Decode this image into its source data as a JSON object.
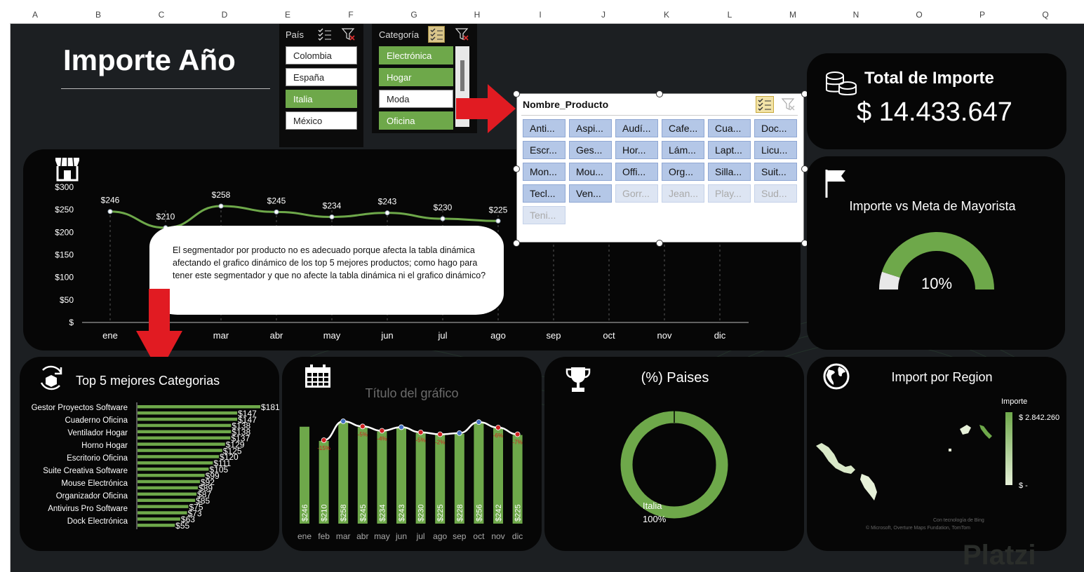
{
  "sheet": {
    "columns": [
      "A",
      "B",
      "C",
      "D",
      "E",
      "F",
      "G",
      "H",
      "I",
      "J",
      "K",
      "L",
      "M",
      "N",
      "O",
      "P",
      "Q"
    ]
  },
  "dashboard": {
    "title": "Importe Año",
    "accent": "#6ea84a"
  },
  "slicer_pais": {
    "header": "País",
    "items": [
      {
        "label": "Colombia",
        "selected": false
      },
      {
        "label": "España",
        "selected": false
      },
      {
        "label": "Italia",
        "selected": true
      },
      {
        "label": "México",
        "selected": false
      }
    ]
  },
  "slicer_categoria": {
    "header": "Categoría",
    "items": [
      {
        "label": "Electrónica",
        "selected": true
      },
      {
        "label": "Hogar",
        "selected": true
      },
      {
        "label": "Moda",
        "selected": false
      },
      {
        "label": "Oficina",
        "selected": true
      }
    ]
  },
  "slicer_producto": {
    "header": "Nombre_Producto",
    "items": [
      {
        "label": "Anti...",
        "disabled": false
      },
      {
        "label": "Aspi...",
        "disabled": false
      },
      {
        "label": "Audí...",
        "disabled": false
      },
      {
        "label": "Cafe...",
        "disabled": false
      },
      {
        "label": "Cua...",
        "disabled": false
      },
      {
        "label": "Doc...",
        "disabled": false
      },
      {
        "label": "Escr...",
        "disabled": false
      },
      {
        "label": "Ges...",
        "disabled": false
      },
      {
        "label": "Hor...",
        "disabled": false
      },
      {
        "label": "Lám...",
        "disabled": false
      },
      {
        "label": "Lapt...",
        "disabled": false
      },
      {
        "label": "Licu...",
        "disabled": false
      },
      {
        "label": "Mon...",
        "disabled": false
      },
      {
        "label": "Mou...",
        "disabled": false
      },
      {
        "label": "Offi...",
        "disabled": false
      },
      {
        "label": "Org...",
        "disabled": false
      },
      {
        "label": "Silla...",
        "disabled": false
      },
      {
        "label": "Suit...",
        "disabled": false
      },
      {
        "label": "Tecl...",
        "disabled": false
      },
      {
        "label": "Ven...",
        "disabled": false
      },
      {
        "label": "Gorr...",
        "disabled": true
      },
      {
        "label": "Jean...",
        "disabled": true
      },
      {
        "label": "Play...",
        "disabled": true
      },
      {
        "label": "Sud...",
        "disabled": true
      },
      {
        "label": "Teni...",
        "disabled": true
      }
    ]
  },
  "total_importe": {
    "title": "Total de Importe",
    "value": "$ 14.433.647"
  },
  "gauge": {
    "title": "Importe vs Meta de  Mayorista",
    "value_label": "10%",
    "fraction": 0.1
  },
  "comment": {
    "text": "El segmentador por producto no es adecuado porque afecta la tabla dinámica afectando el grafico dinámico de los top 5 mejores productos; como hago para tener este segmentador y que no afecte la tabla dinámica ni el grafico dinámico?"
  },
  "top_categories": {
    "title": "Top 5 mejores Categorias",
    "labels": [
      "Gestor Proyectos Software",
      "Cuaderno Oficina",
      "Ventilador Hogar",
      "Horno Hogar",
      "Escritorio Oficina",
      "Suite Creativa Software",
      "Mouse Electrónica",
      "Organizador Oficina",
      "Antivirus Pro Software",
      "Dock Electrónica"
    ]
  },
  "gauge_chart_title": "Título del gráfico",
  "paises": {
    "title": "(%) Paises",
    "label": "Italia",
    "percent": "100%"
  },
  "region": {
    "title": "Import por Region",
    "legend_title": "Importe",
    "legend_max": "$ 2.842.260",
    "legend_min": "$ -",
    "credit1": "Con tecnología de Bing",
    "credit2": "© Microsoft, Overture Maps Fundation, TomTom"
  },
  "watermark": "Platzi",
  "chart_data": [
    {
      "type": "line",
      "categories": [
        "ene",
        "feb",
        "mar",
        "abr",
        "may",
        "jun",
        "jul",
        "ago",
        "sep",
        "oct",
        "nov",
        "dic"
      ],
      "values": [
        246,
        210,
        258,
        245,
        234,
        243,
        230,
        225,
        null,
        null,
        null,
        null
      ],
      "data_labels": [
        "$246",
        "$210",
        "$258",
        "$245",
        "$234",
        "$243",
        "$230",
        "$225"
      ],
      "yticks": [
        "$",
        "$50",
        "$100",
        "$150",
        "$200",
        "$250",
        "$300"
      ],
      "ylim": [
        0,
        300
      ],
      "color": "#6ea84a"
    },
    {
      "type": "bar",
      "title": "Top 5 mejores Categorias",
      "values": [
        181,
        147,
        147,
        138,
        138,
        137,
        129,
        125,
        120,
        111,
        105,
        99,
        92,
        89,
        87,
        85,
        75,
        73,
        63,
        55
      ],
      "data_labels": [
        "$181",
        "$147",
        "$147",
        "$138",
        "$138",
        "$137",
        "$129",
        "$125",
        "$120",
        "$111",
        "$105",
        "$99",
        "$92",
        "$89",
        "$87",
        "$85",
        "$75",
        "$73",
        "$63",
        "$55"
      ],
      "color": "#6ea84a"
    },
    {
      "type": "bar",
      "title": "Título del gráfico",
      "categories": [
        "ene",
        "feb",
        "mar",
        "abr",
        "may",
        "jun",
        "jul",
        "ago",
        "sep",
        "oct",
        "nov",
        "dic"
      ],
      "values": [
        246,
        210,
        258,
        245,
        234,
        243,
        230,
        225,
        228,
        256,
        242,
        225
      ],
      "data_labels": [
        "$246",
        "$210",
        "$258",
        "$245",
        "$234",
        "$243",
        "$230",
        "$225",
        "$228",
        "$256",
        "$242",
        "$225"
      ],
      "change_labels": [
        "",
        "-15%",
        "",
        "-5%",
        "-4%",
        "",
        "-5%",
        "-2%",
        "",
        "",
        "-6%",
        "-7%"
      ],
      "marker_colors": [
        "",
        "#d02020",
        "#4472c4",
        "#d02020",
        "#d02020",
        "#4472c4",
        "#d02020",
        "#d02020",
        "#4472c4",
        "#4472c4",
        "#d02020",
        "#d02020"
      ],
      "color": "#6ea84a"
    },
    {
      "type": "pie",
      "title": "(%) Paises",
      "labels": [
        "Italia"
      ],
      "values": [
        100
      ],
      "color": "#6ea84a"
    }
  ]
}
